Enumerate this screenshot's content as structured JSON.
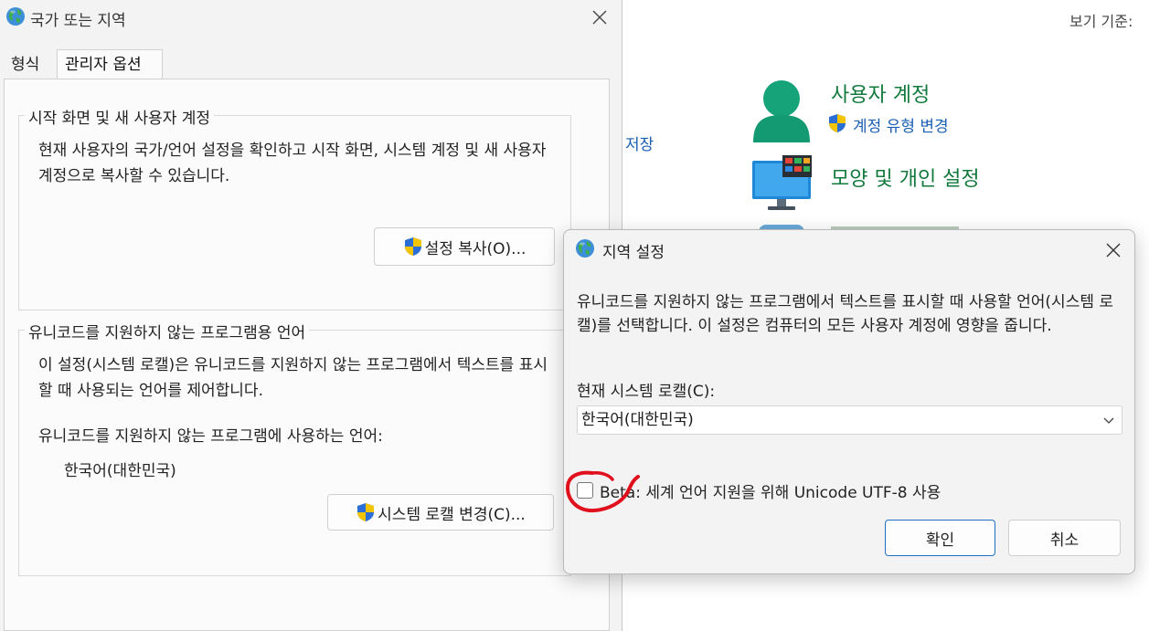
{
  "control_panel": {
    "view_by_label": "보기 기준:",
    "save_link": "저장",
    "user_accounts": {
      "title": "사용자 계정",
      "change_account_type": "계정 유형 변경"
    },
    "appearance": {
      "title": "모양 및 개인 설정"
    }
  },
  "region_dialog": {
    "title": "국가 또는 지역",
    "tabs": [
      "형식",
      "관리자 옵션"
    ],
    "active_tab": "관리자 옵션",
    "welcome_group": {
      "label": "시작 화면 및 새 사용자 계정",
      "description": "현재 사용자의 국가/언어 설정을 확인하고 시작 화면, 시스템 계정 및 새 사용자 계정으로 복사할 수 있습니다.",
      "copy_button": "설정 복사(O)..."
    },
    "unicode_group": {
      "label": "유니코드를 지원하지 않는 프로그램용 언어",
      "description": "이 설정(시스템 로캘)은 유니코드를 지원하지 않는 프로그램에서 텍스트를 표시할 때 사용되는 언어를 제어합니다.",
      "current_language_label": "유니코드를 지원하지 않는 프로그램에 사용하는 언어:",
      "current_language_value": "한국어(대한민국)",
      "change_locale_button": "시스템 로캘 변경(C)..."
    }
  },
  "locale_dialog": {
    "title": "지역 설정",
    "description": "유니코드를 지원하지 않는 프로그램에서 텍스트를 표시할 때 사용할 언어(시스템 로캘)를 선택합니다. 이 설정은 컴퓨터의 모든 사용자 계정에 영향을 줍니다.",
    "current_locale_label": "현재 시스템 로캘(C):",
    "current_locale_value": "한국어(대한민국)",
    "beta_checkbox_label": "Beta: 세계 언어 지원을 위해 Unicode UTF-8 사용",
    "beta_checked": false,
    "ok_button": "확인",
    "cancel_button": "취소"
  },
  "colors": {
    "link_blue": "#1a5fb4",
    "category_green": "#127a3c",
    "annotation_red": "#e0101c",
    "primary_button_border": "#1f6fc0"
  },
  "icons": [
    "globe-icon",
    "close-icon",
    "shield-icon",
    "user-accounts-icon",
    "monitor-icon",
    "chevron-down-icon"
  ]
}
